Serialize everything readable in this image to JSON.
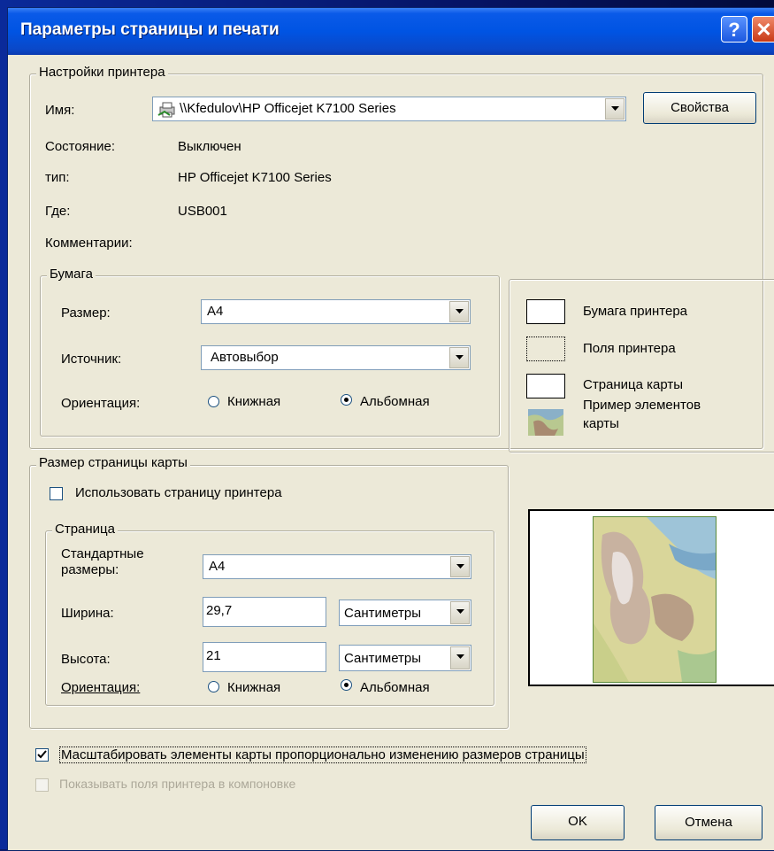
{
  "window": {
    "title": "Параметры страницы и печати",
    "help": "?",
    "close": "✕"
  },
  "printer": {
    "group_title": "Настройки принтера",
    "name_label": "Имя:",
    "name_value": "\\\\Kfedulov\\HP Officejet K7100 Series",
    "properties_button": "Свойства",
    "status_label": "Состояние:",
    "status_value": "Выключен",
    "type_label": "тип:",
    "type_value": "HP Officejet K7100 Series",
    "where_label": "Где:",
    "where_value": "USB001",
    "comment_label": "Комментарии:"
  },
  "paper": {
    "group_title": "Бумага",
    "size_label": "Размер:",
    "size_value": "A4",
    "source_label": "Источник:",
    "source_value": "Автовыбор",
    "orientation_label": "Ориентация:",
    "portrait": "Книжная",
    "landscape": "Альбомная",
    "selected": "landscape"
  },
  "legend": {
    "printer_paper": "Бумага принтера",
    "printer_margins": "Поля принтера",
    "map_page": "Страница карты",
    "map_elements_1": "Пример элементов",
    "map_elements_2": "карты"
  },
  "map_page": {
    "group_title": "Размер страницы карты",
    "use_printer_page": "Использовать страницу принтера",
    "use_printer_page_checked": false,
    "page_group_title": "Страница",
    "standard_sizes_1": "Стандартные",
    "standard_sizes_2": "размеры:",
    "standard_value": "A4",
    "width_label": "Ширина:",
    "width_value": "29,7",
    "width_unit": "Сантиметры",
    "height_label": "Высота:",
    "height_value": "21",
    "height_unit": "Сантиметры",
    "orientation_label": "Ориентация:",
    "portrait": "Книжная",
    "landscape": "Альбомная",
    "selected": "landscape"
  },
  "options": {
    "scale_elements": "Масштабировать элементы карты пропорционально изменению размеров страницы",
    "scale_checked": true,
    "show_margins": "Показывать поля принтера в компоновке",
    "show_margins_checked": false
  },
  "buttons": {
    "ok": "OK",
    "cancel": "Отмена"
  }
}
